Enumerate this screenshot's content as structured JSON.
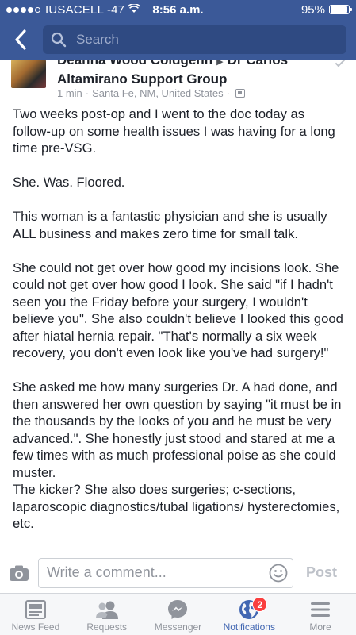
{
  "status_bar": {
    "carrier": "IUSACELL -47",
    "time": "8:56 a.m.",
    "battery": "95%",
    "battery_level": 0.95
  },
  "nav": {
    "back_icon": "chevron-left-icon",
    "search_placeholder": "Search"
  },
  "post": {
    "author_name": "Deanna Wood Coldgenn",
    "group_name_first": "Dr Carlos",
    "group_name_second": "Altamirano Support Group",
    "time": "1 min",
    "location": "Santa Fe, NM, United States",
    "paragraphs": [
      "Two weeks post-op and I went to the doc today as follow-up on some health issues I was having for a long time pre-VSG.",
      "She. Was. Floored.",
      "This woman is a fantastic physician and she is usually ALL business and makes zero time for small talk.",
      "She could not get over how good my incisions look. She could not get over how good I look. She said \"if I hadn't seen you the Friday before your surgery, I wouldn't believe you\". She also couldn't believe I looked this good after hiatal hernia repair. \"That's normally a six week recovery, you don't even look like you've had surgery!\"",
      "She asked me how many surgeries Dr. A had done, and then answered her own question by saying \"it must be in the thousands by the looks of you and he must be very advanced.\". She honestly just stood and stared at me a few times with as much professional poise as she could muster.",
      "The kicker? She also does surgeries; c-sections, laparoscopic diagnostics/tubal ligations/ hysterectomies, etc."
    ]
  },
  "comment_bar": {
    "placeholder": "Write a comment...",
    "post_label": "Post"
  },
  "tabs": [
    {
      "label": "News Feed",
      "icon": "news-feed-icon"
    },
    {
      "label": "Requests",
      "icon": "friend-requests-icon"
    },
    {
      "label": "Messenger",
      "icon": "messenger-icon"
    },
    {
      "label": "Notifications",
      "icon": "globe-icon",
      "badge": "2"
    },
    {
      "label": "More",
      "icon": "menu-icon"
    }
  ],
  "colors": {
    "brand": "#3b5998",
    "active_tab": "#4267b2",
    "badge": "#fa3e3e"
  }
}
